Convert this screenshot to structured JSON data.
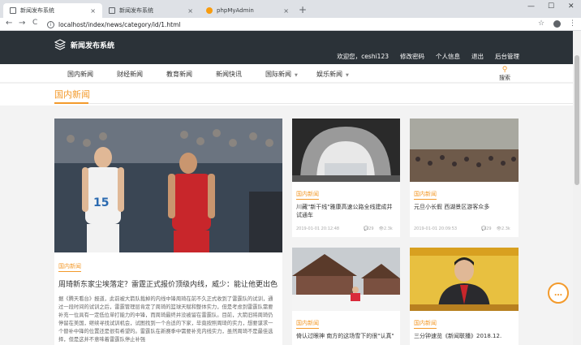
{
  "browser": {
    "tabs": [
      {
        "label": "新闻发布系统",
        "close": "×"
      },
      {
        "label": "新闻发布系统",
        "close": "×"
      },
      {
        "label": "phpMyAdmin",
        "close": "×"
      }
    ],
    "new_tab": "+",
    "window_controls": [
      "—",
      "☐",
      "✕"
    ],
    "url": "localhost/index/news/category/id/1.html",
    "nav": {
      "back": "←",
      "forward": "→",
      "reload": "C"
    },
    "star": "☆",
    "menu": "⋮"
  },
  "site": {
    "logo_text": "新闻发布系统",
    "user_menu": {
      "welcome_prefix": "欢迎您，",
      "username": "ceshi123",
      "change_password": "修改密码",
      "profile": "个人信息",
      "logout": "退出",
      "admin": "后台管理"
    },
    "categories": [
      {
        "label": "国内新闻",
        "caret": ""
      },
      {
        "label": "财经新闻",
        "caret": ""
      },
      {
        "label": "教育新闻",
        "caret": ""
      },
      {
        "label": "新闻快讯",
        "caret": ""
      },
      {
        "label": "国际新闻",
        "caret": "▼"
      },
      {
        "label": "娱乐新闻",
        "caret": "▼"
      }
    ],
    "search_label": "搜索",
    "page_title": "国内新闻"
  },
  "featured": {
    "tag": "国内新闻",
    "title": "周琦新东家尘埃落定？雷霆正式报价顶级内线，威少：能让他更出色",
    "excerpt": "据《腾天看台》报道，此前被大箭队裁掉的内线中锋周琦在前不久正式收到了雷霆队的试训，通过一段时间的试训之后，雷霆管理层肯定了周琦的篮球天赋和整体实力，但是考虑到雷霆队需要补充一位具有一定低位单打能力的中锋，而周琦最终并没被留在雷霆队。目前，大箭旧将周琦仍停留在美国，继续寻找试训机会，试图找到一个合适的下家，毕竟按照周琦的实力，想要谋求一个替补中锋的位置还是很有希望的。雷霆队在新赛季中需要补充内线实力，虽然周琦不是最佳选择，但是这并不意味着雷霆队停止补强"
  },
  "cards": [
    {
      "tag": "国内新闻",
      "title": "川藏\"新干线\"雅康高速公路全线建成并试通车",
      "date": "2019-01-01 20:12:48",
      "comments": "29",
      "views": "2.3k"
    },
    {
      "tag": "国内新闻",
      "title": "元旦小长假 西湖景区游客众多",
      "date": "2019-01-01 20:09:53",
      "comments": "29",
      "views": "2.3k"
    },
    {
      "tag": "国内新闻",
      "title": "倚认过眼神 南方的这场雪下的很\"认真\"",
      "date": "",
      "comments": "",
      "views": ""
    },
    {
      "tag": "国内新闻",
      "title": "三分钟速览《新闻联播》2018.12.",
      "date": "",
      "comments": "",
      "views": ""
    }
  ],
  "icons": {
    "comment": "comment-icon",
    "eye": "eye-icon",
    "chat": "chat-icon"
  },
  "colors": {
    "accent": "#f39a2b",
    "header_bg": "#2b3238"
  }
}
